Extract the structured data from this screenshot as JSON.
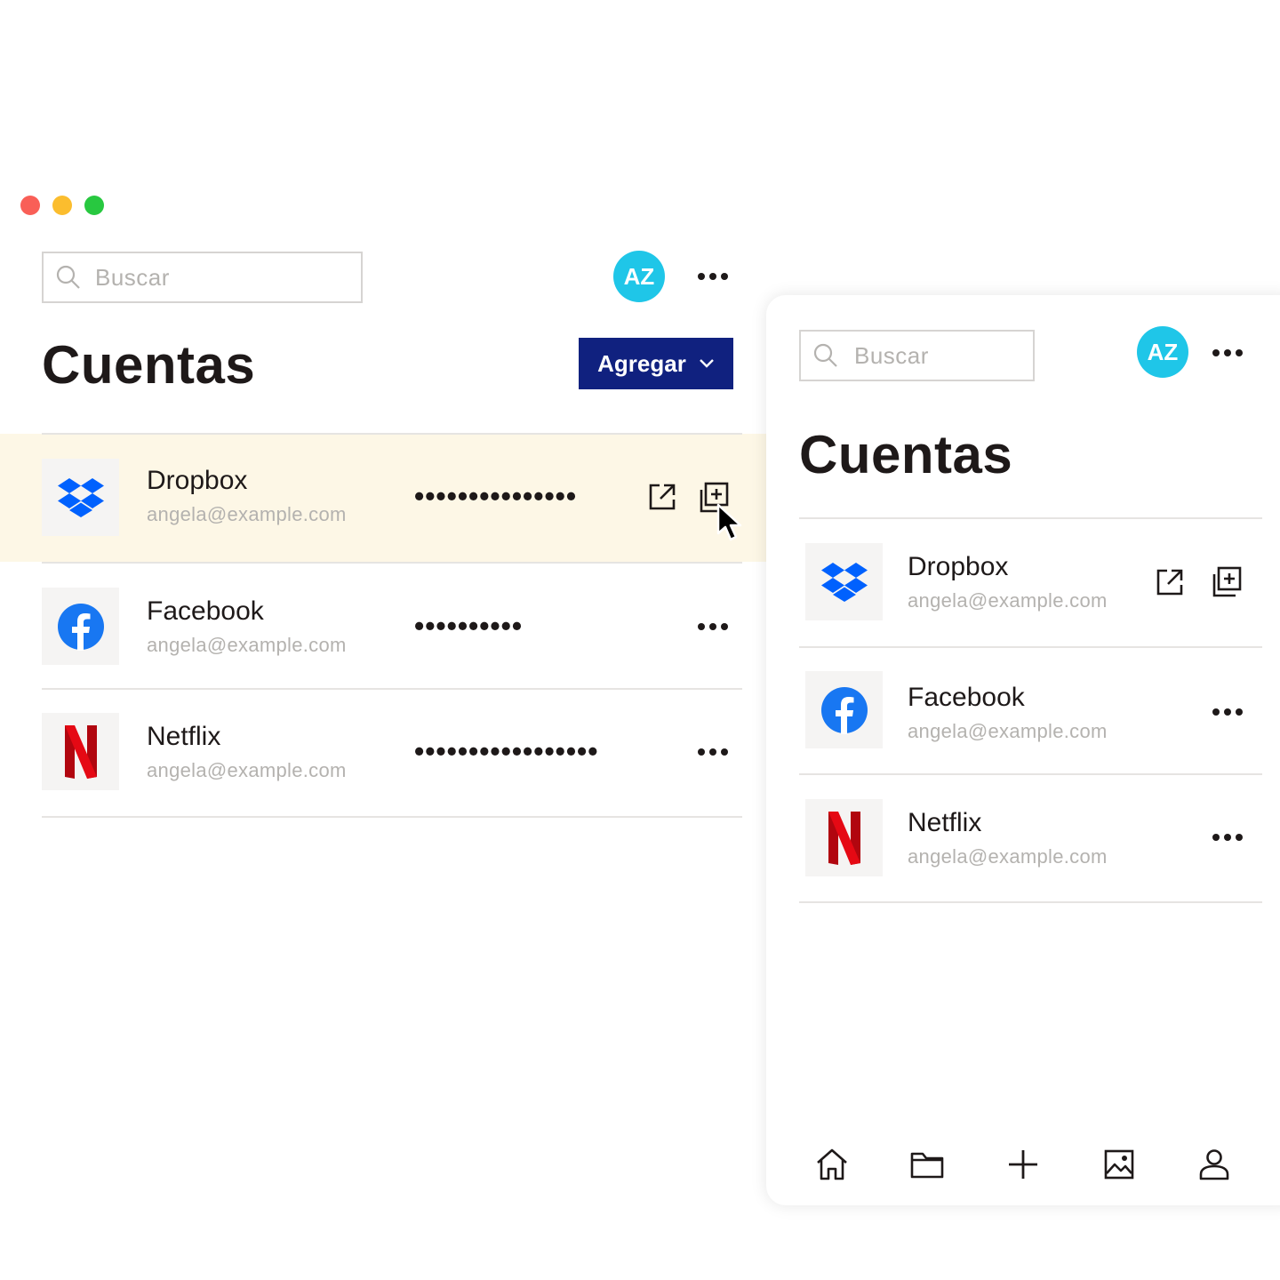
{
  "window": {
    "traffic_lights": [
      "#f95f57",
      "#fbbd2e",
      "#28c840"
    ]
  },
  "desktop": {
    "search": {
      "placeholder": "Buscar"
    },
    "avatar": {
      "initials": "AZ",
      "color": "#1fc6e8"
    },
    "title": "Cuentas",
    "add_button": {
      "label": "Agregar",
      "color": "#10217f"
    },
    "highlight_color": "#fdf7e6",
    "accounts": [
      {
        "name": "Dropbox",
        "email": "angela@example.com",
        "password_mask": "•••••••••••••••",
        "logo": "dropbox-logo",
        "actions": [
          "open-external-icon",
          "copy-icon"
        ]
      },
      {
        "name": "Facebook",
        "email": "angela@example.com",
        "password_mask": "••••••••••",
        "logo": "facebook-logo",
        "actions": [
          "more-icon"
        ]
      },
      {
        "name": "Netflix",
        "email": "angela@example.com",
        "password_mask": "•••••••••••••••••",
        "logo": "netflix-logo",
        "actions": [
          "more-icon"
        ]
      }
    ]
  },
  "mobile": {
    "search": {
      "placeholder": "Buscar"
    },
    "avatar": {
      "initials": "AZ",
      "color": "#1fc6e8"
    },
    "title": "Cuentas",
    "accounts": [
      {
        "name": "Dropbox",
        "email": "angela@example.com",
        "logo": "dropbox-logo",
        "actions": [
          "open-external-icon",
          "copy-icon"
        ]
      },
      {
        "name": "Facebook",
        "email": "angela@example.com",
        "logo": "facebook-logo",
        "actions": [
          "more-icon"
        ]
      },
      {
        "name": "Netflix",
        "email": "angela@example.com",
        "logo": "netflix-logo",
        "actions": [
          "more-icon"
        ]
      }
    ],
    "tabbar": [
      "home-icon",
      "folder-icon",
      "plus-icon",
      "photo-icon",
      "user-icon"
    ]
  },
  "colors": {
    "dropbox": "#0061fe",
    "facebook": "#1877f2",
    "netflix": "#e50914",
    "text": "#1e1919",
    "muted": "#b4b2af"
  }
}
